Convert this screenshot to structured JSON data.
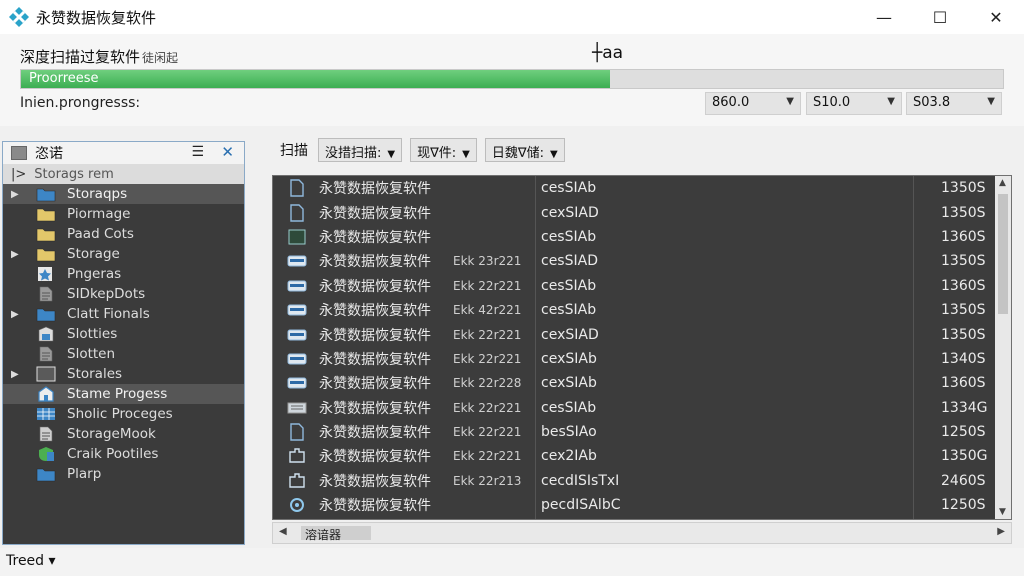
{
  "window": {
    "title": "永赞数据恢复软件",
    "controls": {
      "minimize": "—",
      "maximize": "☐",
      "close": "✕"
    }
  },
  "scan": {
    "title": "深度扫描过复软件",
    "title_sub": "徒闲起",
    "center_text": "┼aa",
    "progress": {
      "label": "Proorreese",
      "fraction": 0.6
    },
    "intern_label": "Inien.prongresss:",
    "selects": [
      {
        "value": "860.0"
      },
      {
        "value": "S10.0"
      },
      {
        "value": "S03.8"
      }
    ]
  },
  "tree": {
    "title": "恣诺",
    "search_value": "Storags rem",
    "items": [
      {
        "label": "Storaqps",
        "arrow": true,
        "icon": "folder-icon",
        "color": "#3d86c6",
        "selected": true
      },
      {
        "label": "Piormage",
        "arrow": false,
        "icon": "folder-icon",
        "color": "#e3c76a",
        "selected": false
      },
      {
        "label": "Paad Cots",
        "arrow": false,
        "icon": "folder-icon",
        "color": "#e3c76a",
        "selected": false
      },
      {
        "label": "Storage",
        "arrow": true,
        "icon": "folder-icon",
        "color": "#e3c76a",
        "selected": false
      },
      {
        "label": "Pngeras",
        "arrow": false,
        "icon": "star-icon",
        "color": "#3d86c6",
        "selected": false
      },
      {
        "label": "SIDkepDots",
        "arrow": false,
        "icon": "document-icon",
        "color": "#9a9a9a",
        "selected": false
      },
      {
        "label": "Clatt Fionals",
        "arrow": true,
        "icon": "folder-icon",
        "color": "#3d86c6",
        "selected": false
      },
      {
        "label": "Slotties",
        "arrow": false,
        "icon": "badge-icon",
        "color": "#3d86c6",
        "selected": false
      },
      {
        "label": "Slotten",
        "arrow": false,
        "icon": "document-icon",
        "color": "#9a9a9a",
        "selected": false
      },
      {
        "label": "Storales",
        "arrow": true,
        "icon": "monitor-icon",
        "color": "#5a5a5a",
        "selected": false
      },
      {
        "label": "Stame Progess",
        "arrow": false,
        "icon": "building-icon",
        "color": "#3d86c6",
        "selected": true
      },
      {
        "label": "Sholic Proceges",
        "arrow": false,
        "icon": "grid-icon",
        "color": "#3d86c6",
        "selected": false
      },
      {
        "label": "StorageMook",
        "arrow": false,
        "icon": "document-icon",
        "color": "#cfcfcf",
        "selected": false
      },
      {
        "label": "Craik Pootiles",
        "arrow": false,
        "icon": "shield-icon",
        "color": "#4caf50",
        "selected": false
      },
      {
        "label": "Plarp",
        "arrow": false,
        "icon": "folder-icon",
        "color": "#3d86c6",
        "selected": false
      }
    ]
  },
  "filters": {
    "label": "扫描",
    "options": [
      {
        "value": "没措扫描:"
      },
      {
        "value": "现∇件:"
      },
      {
        "value": "日魏∇储:"
      }
    ]
  },
  "files": [
    {
      "icon": "file-icon",
      "name": "永赞数据恢复软件",
      "extra": "",
      "code": "cesSIAb",
      "size": "1350S"
    },
    {
      "icon": "file-icon",
      "name": "永赞数据恢复软件",
      "extra": "",
      "code": "cexSIAD",
      "size": "1350S"
    },
    {
      "icon": "image-icon",
      "name": "永赞数据恢复软件",
      "extra": "",
      "code": "cesSIAb",
      "size": "1360S"
    },
    {
      "icon": "drive-icon",
      "name": "永赞数据恢复软件",
      "extra": "Ekk 23r221",
      "code": "cesSIAD",
      "size": "1350S"
    },
    {
      "icon": "drive-icon",
      "name": "永赞数据恢复软件",
      "extra": "Ekk 22r221",
      "code": "cesSIAb",
      "size": "1360S"
    },
    {
      "icon": "drive-icon",
      "name": "永赞数据恢复软件",
      "extra": "Ekk 42r221",
      "code": "cesSIAb",
      "size": "1350S"
    },
    {
      "icon": "drive-icon",
      "name": "永赞数据恢复软件",
      "extra": "Ekk 22r221",
      "code": "cexSIAD",
      "size": "1350S"
    },
    {
      "icon": "drive-icon",
      "name": "永赞数据恢复软件",
      "extra": "Ekk 22r221",
      "code": "cexSIAb",
      "size": "1340S"
    },
    {
      "icon": "drive-icon",
      "name": "永赞数据恢复软件",
      "extra": "Ekk 22r228",
      "code": "cexSIAb",
      "size": "1360S"
    },
    {
      "icon": "hdd-icon",
      "name": "永赞数据恢复软件",
      "extra": "Ekk 22r221",
      "code": "cesSIAb",
      "size": "1334G"
    },
    {
      "icon": "file-icon",
      "name": "永赞数据恢复软件",
      "extra": "Ekk 22r221",
      "code": "besSIAo",
      "size": "1250S"
    },
    {
      "icon": "puzzle-icon",
      "name": "永赞数据恢复软件",
      "extra": "Ekk 22r221",
      "code": "cex2IAb",
      "size": "1350G"
    },
    {
      "icon": "puzzle-icon",
      "name": "永赞数据恢复软件",
      "extra": "Ekk 22r213",
      "code": "cecdISIsTxI",
      "size": "2460S"
    },
    {
      "icon": "gear-icon",
      "name": "永赞数据恢复软件",
      "extra": "",
      "code": "pecdISAlbC",
      "size": "1250S"
    }
  ],
  "hscroll": {
    "thumb_text": "溶谙器"
  },
  "status": {
    "text": "Treed ▾"
  }
}
